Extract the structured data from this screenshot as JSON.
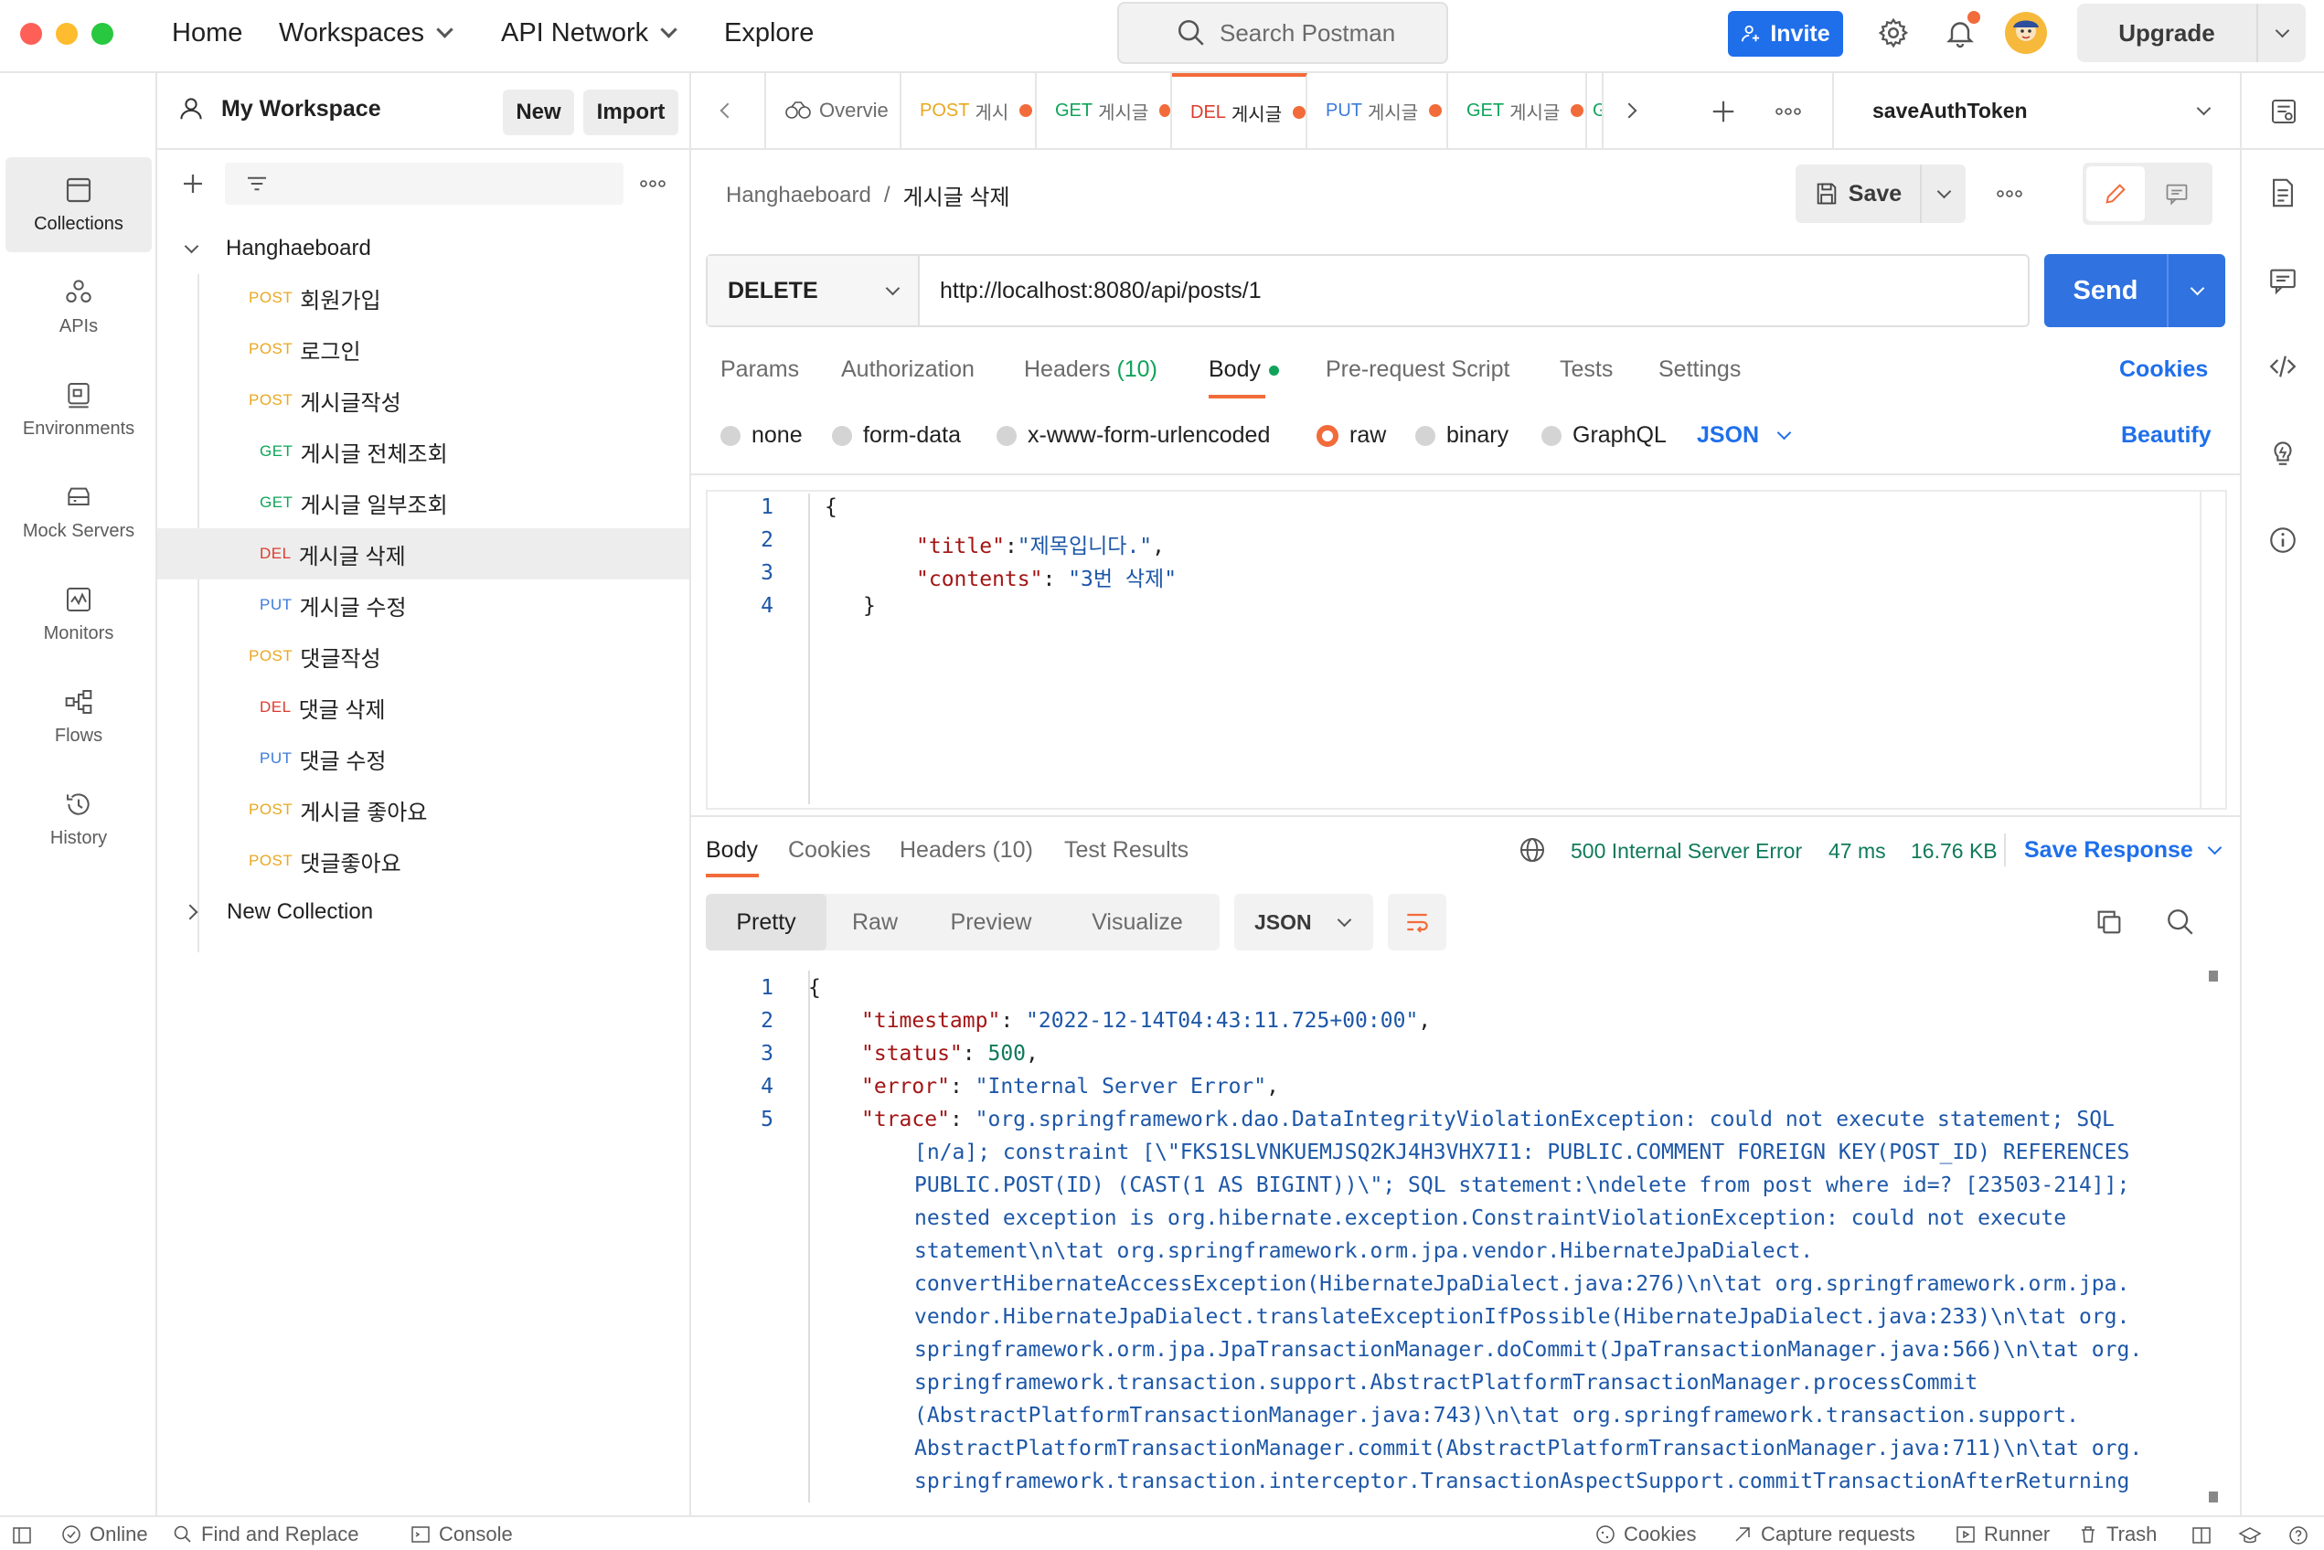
{
  "window": {
    "traffic_colors": [
      "#fe5f57",
      "#febc2e",
      "#28c840"
    ]
  },
  "topnav": {
    "home": "Home",
    "workspaces": "Workspaces",
    "api_network": "API Network",
    "explore": "Explore",
    "search_placeholder": "Search Postman",
    "invite": "Invite",
    "upgrade": "Upgrade"
  },
  "rail": {
    "items": [
      {
        "label": "Collections",
        "icon": "collections-icon",
        "active": true
      },
      {
        "label": "APIs",
        "icon": "apis-icon"
      },
      {
        "label": "Environments",
        "icon": "environments-icon"
      },
      {
        "label": "Mock Servers",
        "icon": "mock-servers-icon"
      },
      {
        "label": "Monitors",
        "icon": "monitors-icon"
      },
      {
        "label": "Flows",
        "icon": "flows-icon"
      },
      {
        "label": "History",
        "icon": "history-icon"
      }
    ]
  },
  "sidebar": {
    "workspace": "My Workspace",
    "new_label": "New",
    "import_label": "Import",
    "collection_name": "Hanghaeboard",
    "requests": [
      {
        "method": "POST",
        "name": "회원가입"
      },
      {
        "method": "POST",
        "name": "로그인"
      },
      {
        "method": "POST",
        "name": "게시글작성"
      },
      {
        "method": "GET",
        "name": "게시글 전체조회"
      },
      {
        "method": "GET",
        "name": "게시글 일부조회"
      },
      {
        "method": "DEL",
        "name": "게시글 삭제"
      },
      {
        "method": "PUT",
        "name": "게시글 수정"
      },
      {
        "method": "POST",
        "name": "댓글작성"
      },
      {
        "method": "DEL",
        "name": "댓글 삭제"
      },
      {
        "method": "PUT",
        "name": "댓글 수정"
      },
      {
        "method": "POST",
        "name": "게시글 좋아요"
      },
      {
        "method": "POST",
        "name": "댓글좋아요"
      }
    ],
    "second_collection": "New Collection"
  },
  "tabs": [
    {
      "method": "",
      "name": "Overvie"
    },
    {
      "method": "POST",
      "name": "게시"
    },
    {
      "method": "GET",
      "name": "게시글"
    },
    {
      "method": "DEL",
      "name": "게시글"
    },
    {
      "method": "PUT",
      "name": "게시글"
    },
    {
      "method": "GET",
      "name": "게시글"
    },
    {
      "method": "G",
      "name": ""
    }
  ],
  "environment": "saveAuthToken",
  "request": {
    "breadcrumb_collection": "Hanghaeboard",
    "breadcrumb_sep": "/",
    "breadcrumb_name": "게시글 삭제",
    "save": "Save",
    "method": "DELETE",
    "url": "http://localhost:8080/api/posts/1",
    "send": "Send",
    "subtabs": {
      "params": "Params",
      "authorization": "Authorization",
      "headers": "Headers",
      "headers_count": "(10)",
      "body": "Body",
      "prerequest": "Pre-request Script",
      "tests": "Tests",
      "settings": "Settings",
      "cookies": "Cookies"
    },
    "body_types": {
      "none": "none",
      "form_data": "form-data",
      "urlencoded": "x-www-form-urlencoded",
      "raw": "raw",
      "binary": "binary",
      "graphql": "GraphQL",
      "format": "JSON",
      "beautify": "Beautify"
    },
    "body_lines": {
      "l1": "{",
      "l2_key": "\"title\"",
      "l2_colon": ":",
      "l2_val": "\"제목입니다.\"",
      "l2_tail": ",",
      "l3_key": "\"contents\"",
      "l3_colon": ": ",
      "l3_val": "\"3번 삭제\"",
      "l4": "}"
    }
  },
  "response": {
    "tabs": {
      "body": "Body",
      "cookies": "Cookies",
      "headers": "Headers",
      "headers_count": "(10)",
      "test_results": "Test Results"
    },
    "status": "500 Internal Server Error",
    "time": "47 ms",
    "size": "16.76 KB",
    "save_response": "Save Response",
    "views": {
      "pretty": "Pretty",
      "raw": "Raw",
      "preview": "Preview",
      "visualize": "Visualize",
      "format": "JSON"
    },
    "lines": {
      "l1": "{",
      "ts_key": "\"timestamp\"",
      "ts_val": "\"2022-12-14T04:43:11.725+00:00\"",
      "status_key": "\"status\"",
      "status_val": "500",
      "error_key": "\"error\"",
      "error_val": "\"Internal Server Error\"",
      "trace_key": "\"trace\"",
      "trace_wrap": [
        "\"org.springframework.dao.DataIntegrityViolationException: could not execute statement; SQL",
        "[n/a]; constraint [\\\"FKS1SLVNKUEMJSQ2KJ4H3VHX7I1: PUBLIC.COMMENT FOREIGN KEY(POST_ID) REFERENCES",
        "PUBLIC.POST(ID) (CAST(1 AS BIGINT))\\\"; SQL statement:\\ndelete from post where id=? [23503-214]];",
        "nested exception is org.hibernate.exception.ConstraintViolationException: could not execute",
        "statement\\n\\tat org.springframework.orm.jpa.vendor.HibernateJpaDialect.",
        "convertHibernateAccessException(HibernateJpaDialect.java:276)\\n\\tat org.springframework.orm.jpa.",
        "vendor.HibernateJpaDialect.translateExceptionIfPossible(HibernateJpaDialect.java:233)\\n\\tat org.",
        "springframework.orm.jpa.JpaTransactionManager.doCommit(JpaTransactionManager.java:566)\\n\\tat org.",
        "springframework.transaction.support.AbstractPlatformTransactionManager.processCommit",
        "(AbstractPlatformTransactionManager.java:743)\\n\\tat org.springframework.transaction.support.",
        "AbstractPlatformTransactionManager.commit(AbstractPlatformTransactionManager.java:711)\\n\\tat org.",
        "springframework.transaction.interceptor.TransactionAspectSupport.commitTransactionAfterReturning"
      ]
    }
  },
  "statusbar": {
    "online": "Online",
    "find_replace": "Find and Replace",
    "console": "Console",
    "cookies": "Cookies",
    "capture": "Capture requests",
    "runner": "Runner",
    "trash": "Trash"
  },
  "colors": {
    "accent_blue": "#1f6feb",
    "send_blue": "#2f72e0",
    "tab_active": "#f26b3a",
    "post": "#e9a820",
    "get": "#0fa45a",
    "del": "#dc3b2e",
    "put": "#3d7bd9"
  }
}
